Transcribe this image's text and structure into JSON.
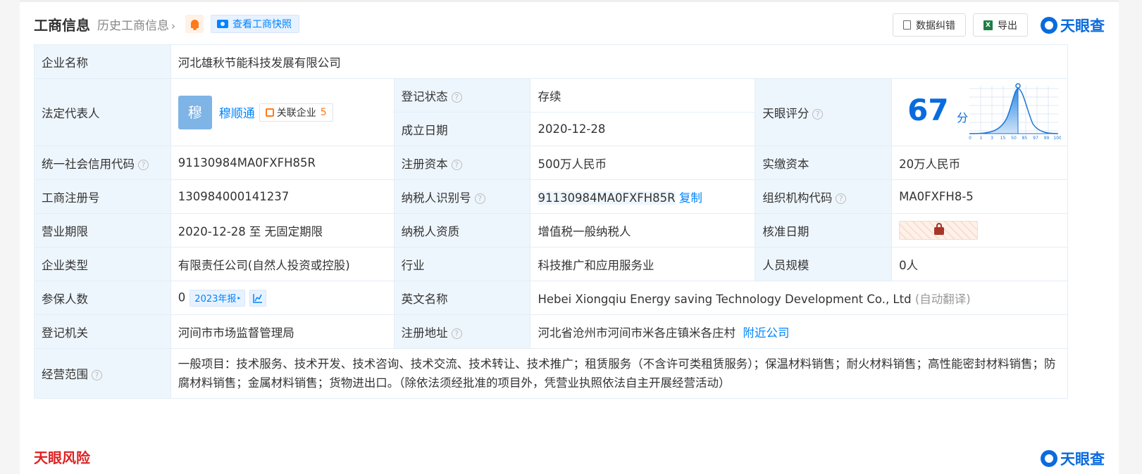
{
  "header": {
    "title": "工商信息",
    "history_link": "历史工商信息",
    "snapshot_button": "查看工商快照",
    "correction_button": "数据纠错",
    "export_button": "导出",
    "logo_text": "天眼查",
    "export_icon_text": "X"
  },
  "labels": {
    "company_name": "企业名称",
    "legal_rep": "法定代表人",
    "reg_status": "登记状态",
    "established": "成立日期",
    "tianyan_score": "天眼评分",
    "credit_code": "统一社会信用代码",
    "reg_capital": "注册资本",
    "paid_capital": "实缴资本",
    "reg_number": "工商注册号",
    "taxpayer_id": "纳税人识别号",
    "org_code": "组织机构代码",
    "business_term": "营业期限",
    "taxpayer_qual": "纳税人资质",
    "approval_date": "核准日期",
    "company_type": "企业类型",
    "industry": "行业",
    "staff_size": "人员规模",
    "insured_count": "参保人数",
    "english_name": "英文名称",
    "reg_authority": "登记机关",
    "reg_address": "注册地址",
    "business_scope": "经营范围"
  },
  "values": {
    "company_name": "河北雄秋节能科技发展有限公司",
    "legal_rep_avatar": "穆",
    "legal_rep_name": "穆顺通",
    "related_companies_label": "关联企业",
    "related_companies_count": "5",
    "reg_status": "存续",
    "established": "2020-12-28",
    "score": "67",
    "score_unit": "分",
    "credit_code": "91130984MA0FXFH85R",
    "reg_capital": "500万人民币",
    "paid_capital": "20万人民币",
    "reg_number": "130984000141237",
    "taxpayer_id": "91130984MA0FXFH85R",
    "copy_link": "复制",
    "org_code": "MA0FXFH8-5",
    "business_term": "2020-12-28 至 无固定期限",
    "taxpayer_qual": "增值税一般纳税人",
    "company_type": "有限责任公司(自然人投资或控股)",
    "industry": "科技推广和应用服务业",
    "staff_size": "0人",
    "insured_count": "0",
    "annual_report": "2023年报",
    "english_name": "Hebei Xiongqiu Energy saving Technology Development Co., Ltd",
    "auto_translate": "(自动翻译)",
    "reg_authority": "河间市市场监督管理局",
    "reg_address": "河北省沧州市河间市米各庄镇米各庄村",
    "nearby_link": "附近公司",
    "business_scope": "一般项目：技术服务、技术开发、技术咨询、技术交流、技术转让、技术推广；租赁服务（不含许可类租赁服务）；保温材料销售；耐火材料销售；高性能密封材料销售；防腐材料销售；金属材料销售；货物进出口。（除依法须经批准的项目外，凭营业执照依法自主开展经营活动）"
  },
  "score_chart": {
    "ticks": [
      "0",
      "1",
      "3",
      "15",
      "50",
      "85",
      "97",
      "99",
      "100"
    ]
  },
  "footer": {
    "risk_title": "天眼风险",
    "logo_text": "天眼查"
  },
  "colors": {
    "primary": "#0084ff",
    "brand": "#0a6bde",
    "status_green": "#1aa34a",
    "accent_orange": "#ff7a1a",
    "risk_red": "#e02020"
  }
}
